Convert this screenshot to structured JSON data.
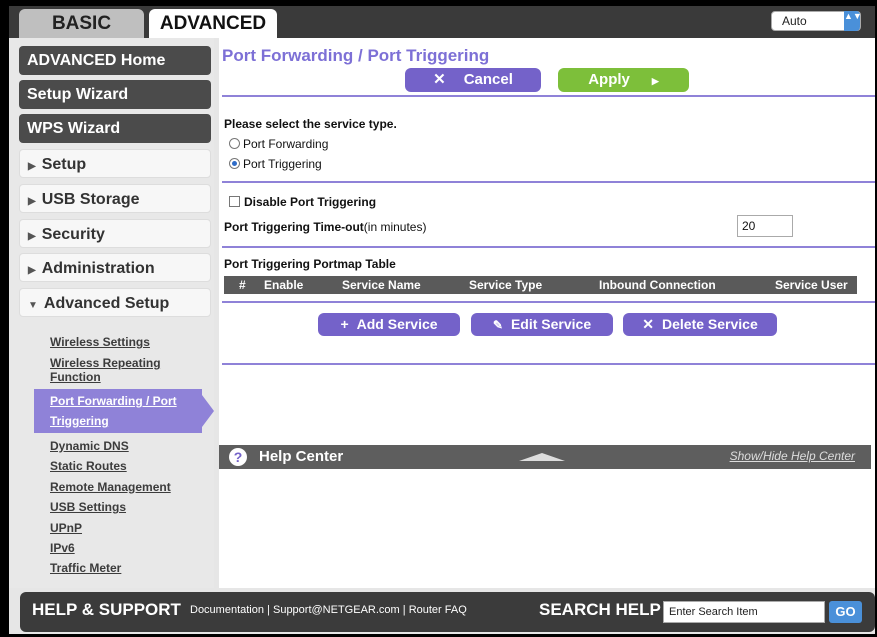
{
  "tabs": {
    "basic": "BASIC",
    "advanced": "ADVANCED"
  },
  "language": {
    "selected": "Auto",
    "arrow_glyph": "▲▼"
  },
  "sidebar": {
    "main_items": [
      {
        "label": "ADVANCED Home"
      },
      {
        "label": "Setup Wizard"
      },
      {
        "label": "WPS Wizard"
      },
      {
        "label": "Setup"
      },
      {
        "label": "USB Storage"
      },
      {
        "label": "Security"
      },
      {
        "label": "Administration"
      },
      {
        "label": "Advanced Setup"
      }
    ],
    "sub_items": [
      {
        "label": "Wireless Settings"
      },
      {
        "label": "Wireless Repeating"
      },
      {
        "label": "Function"
      },
      {
        "label": "Port Forwarding / Port"
      },
      {
        "label": "Triggering"
      },
      {
        "label": "Dynamic DNS"
      },
      {
        "label": "Static Routes"
      },
      {
        "label": "Remote Management"
      },
      {
        "label": "USB Settings"
      },
      {
        "label": "UPnP"
      },
      {
        "label": "IPv6"
      },
      {
        "label": "Traffic Meter"
      }
    ]
  },
  "page": {
    "title": "Port Forwarding / Port Triggering",
    "cancel_label": "Cancel",
    "apply_label": "Apply",
    "service_type_prompt": "Please select the service type.",
    "option_forwarding": "Port Forwarding",
    "option_triggering": "Port Triggering",
    "selected_option": "Port Triggering",
    "disable_label": "Disable Port Triggering",
    "timeout_label": "Port Triggering Time-out",
    "timeout_unit": "(in minutes)",
    "timeout_value": "20",
    "table_title": "Port Triggering Portmap Table",
    "table_headers": [
      "#",
      "Enable",
      "Service Name",
      "Service Type",
      "Inbound Connection",
      "Service User"
    ],
    "add_label": "Add Service",
    "edit_label": "Edit Service",
    "delete_label": "Delete Service"
  },
  "help_center": {
    "label": "Help Center",
    "toggle_link": "Show/Hide Help Center"
  },
  "footer": {
    "help_support": "HELP & SUPPORT",
    "documentation": "Documentation",
    "support_email": "Support@NETGEAR.com",
    "router_faq": "Router FAQ",
    "search_help": "SEARCH HELP",
    "search_placeholder": "Enter Search Item",
    "go_label": "GO"
  },
  "colors": {
    "accent": "#7462c9",
    "apply": "#7dbf3a",
    "selected_nav": "#8f82d8"
  }
}
